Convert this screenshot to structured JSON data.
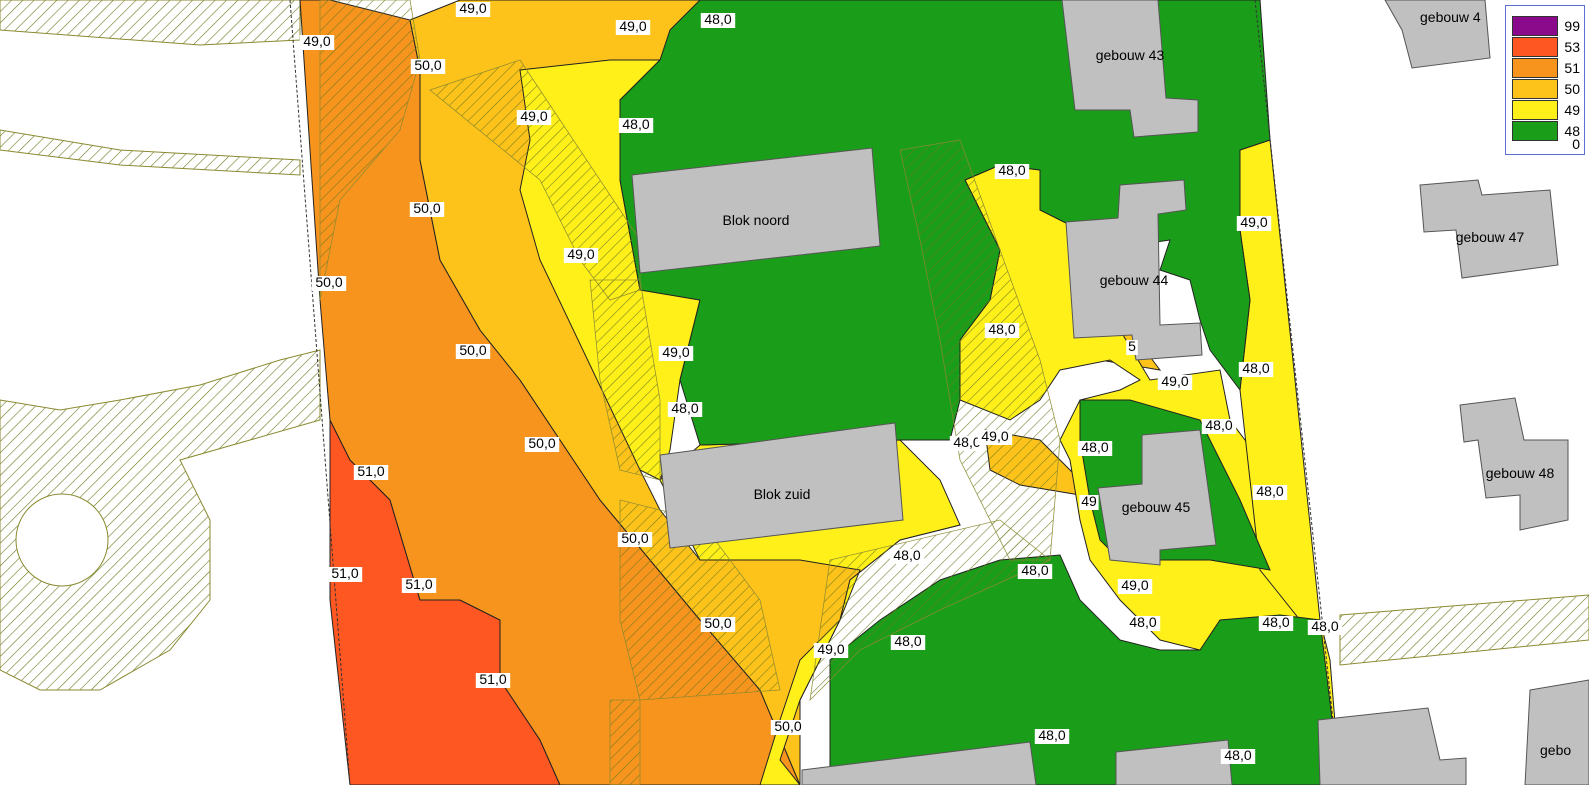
{
  "legend": [
    {
      "label": "99",
      "color": "#8b0a8b"
    },
    {
      "label": "53",
      "color": "#ff5722"
    },
    {
      "label": "51",
      "color": "#f7941d"
    },
    {
      "label": "50",
      "color": "#fdc31a"
    },
    {
      "label": "49",
      "color": "#fff01a"
    },
    {
      "label": "48",
      "color": "#1a9e1a"
    },
    {
      "label": "0",
      "color": ""
    }
  ],
  "buildings": {
    "blok_noord": "Blok noord",
    "blok_zuid": "Blok zuid",
    "gebouw_43": "gebouw 43",
    "gebouw_44": "gebouw 44",
    "gebouw_45": "gebouw 45",
    "gebouw_47": "gebouw 47",
    "gebouw_48": "gebouw 48",
    "gebouw_4x": "gebouw 4",
    "gebouw_edge": "gebo"
  },
  "contours": {
    "c1": "49,0",
    "c2": "49,0",
    "c3": "48,0",
    "c4": "49,0",
    "c5": "50,0",
    "c6": "49,0",
    "c7": "48,0",
    "c8": "50,0",
    "c9": "49,0",
    "c10": "50,0",
    "c11": "49,0",
    "c12": "50,0",
    "c13": "48,0",
    "c14": "50,0",
    "c15": "51,0",
    "c16": "51,0",
    "c17": "51,0",
    "c18": "50,0",
    "c19": "50,0",
    "c20": "51,0",
    "c21": "50,0",
    "c22": "49,0",
    "c23": "48,0",
    "c24": "48,0",
    "c25": "48,0",
    "c26": "49,0",
    "c27": "48,0",
    "c28": "49,0",
    "c29": "48,0",
    "c30": "48,0",
    "c31": "48,0",
    "c32": "48,0",
    "c33": "48,0",
    "c34": "49,0",
    "c35": "48,0",
    "c36": "48,0",
    "c37": "48,0",
    "c38": "48,0",
    "c39": "48,0",
    "c40": "49,0",
    "c41": "49",
    "c42": "5",
    "c43": "48,0"
  },
  "colors": {
    "green": "#1a9e1a",
    "yellow": "#fff01a",
    "lightorange": "#fdc31a",
    "orange": "#f7941d",
    "red": "#ff5722",
    "building": "#c0c0c0",
    "hatch": "#6b7a20"
  }
}
